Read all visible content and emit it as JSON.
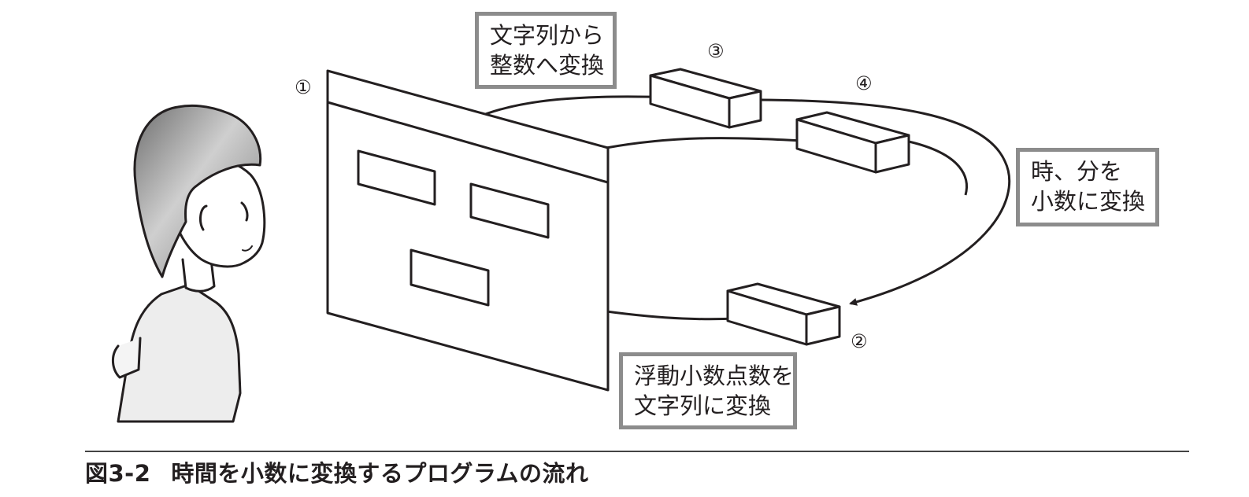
{
  "diagram": {
    "markers": {
      "m1": "①",
      "m2": "②",
      "m3": "③",
      "m4": "④"
    },
    "callouts": {
      "string_to_int": {
        "line1": "文字列から",
        "line2": "整数へ変換"
      },
      "hm_to_decimal": {
        "line1": "時、分を",
        "line2": "小数に変換"
      },
      "float_to_string": {
        "line1": "浮動小数点数を",
        "line2": "文字列に変換"
      }
    },
    "colors": {
      "line": "#231f20",
      "gray_path": "#b3b3b3",
      "callout_border": "#8c8c8c",
      "hair": "#8a8a8a"
    }
  },
  "caption": {
    "figure_number": "図3-2",
    "title": "時間を小数に変換するプログラムの流れ"
  }
}
